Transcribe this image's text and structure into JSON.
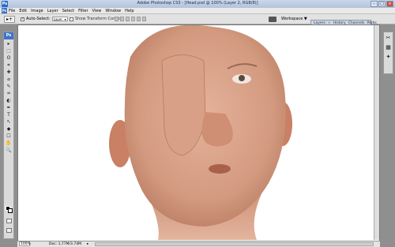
{
  "window": {
    "title": "Adobe Photoshop CS3 - [Head.psd @ 100% (Layer 2, RGB/8)]"
  },
  "menu": [
    "File",
    "Edit",
    "Image",
    "Layer",
    "Select",
    "Filter",
    "View",
    "Window",
    "Help"
  ],
  "options": {
    "tool_preset": "▸+",
    "auto_select_label": "Auto-Select:",
    "auto_select_value": "Layer",
    "show_transform_label": "Show Transform Controls",
    "workspace_label": "Workspace ▼"
  },
  "palette_well": [
    "Layers",
    "History",
    "Channels",
    "Paths"
  ],
  "toolbox_header": "Ps",
  "tools": [
    "▸",
    "⬚",
    "ʘ",
    "⌗",
    "✚",
    "⌀",
    "✎",
    "♒",
    "◐",
    "✒",
    "T",
    "↖",
    "◆",
    "☐",
    "✋",
    "🔍"
  ],
  "right_dock": [
    "✂",
    "▦",
    "✦"
  ],
  "status": {
    "zoom": "100%",
    "doc": "Doc: 1,77M/3.74M",
    "arrow": "▸"
  },
  "colors": {
    "skin": "#d9a48a",
    "skin_shadow": "#b97d62",
    "title_bar": "#b3c3d9",
    "canvas_bg": "#ffffff"
  }
}
